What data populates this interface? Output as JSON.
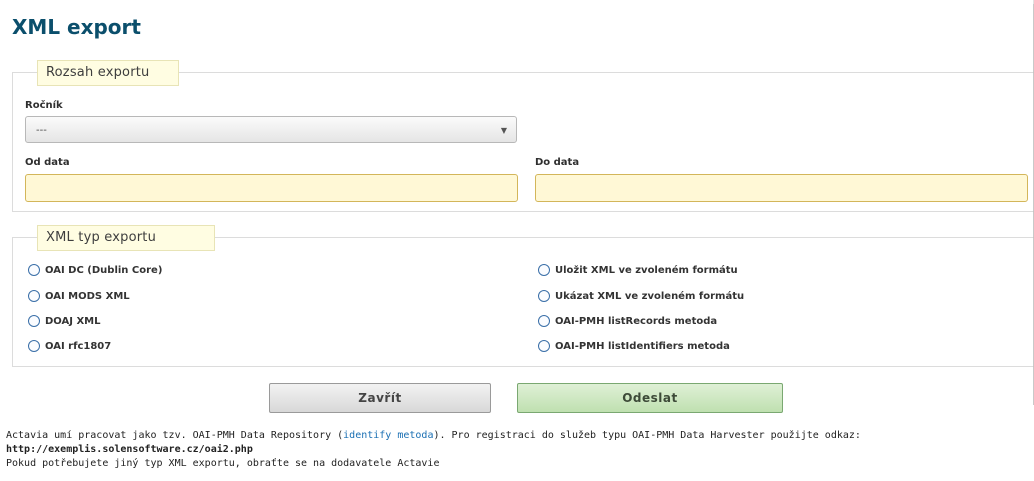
{
  "dialog": {
    "title": "XML export"
  },
  "range_section": {
    "legend": "Rozsah exportu",
    "year_label": "Ročník",
    "year_value": "---",
    "from_label": "Od data",
    "to_label": "Do data"
  },
  "type_section": {
    "legend": "XML typ exportu",
    "left_options": [
      "OAI DC (Dublin Core)",
      "OAI MODS XML",
      "DOAJ XML",
      "OAI rfc1807"
    ],
    "right_options": [
      "Uložit XML ve zvoleném formátu",
      "Ukázat XML ve zvoleném formátu",
      "OAI-PMH listRecords metoda",
      "OAI-PMH listIdentifiers metoda"
    ]
  },
  "buttons": {
    "close": "Zavřít",
    "send": "Odeslat"
  },
  "footer": {
    "line1_prefix": "Actavia umí pracovat jako tzv. OAI-PMH Data Repository (",
    "line1_link": "identify metoda",
    "line1_suffix": "). Pro registraci do služeb typu OAI-PMH Data Harvester použijte odkaz:",
    "url": "http://exemplis.solensoftware.cz/oai2.php",
    "line3": "Pokud potřebujete jiný typ XML exportu, obraťte se na dodavatele Actavie"
  }
}
